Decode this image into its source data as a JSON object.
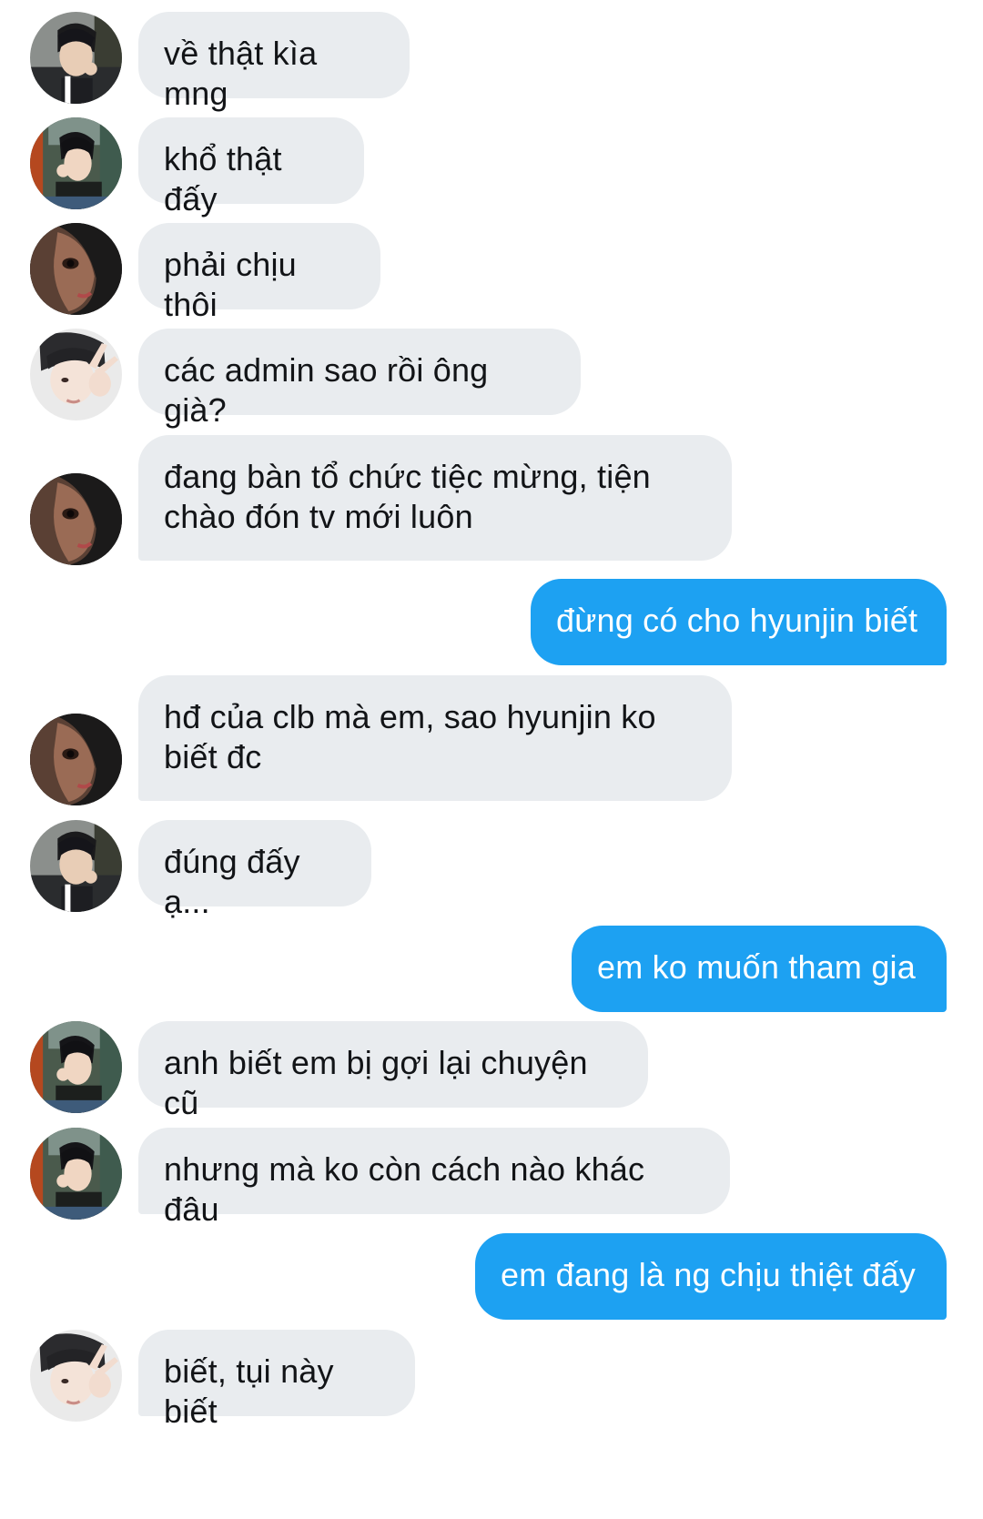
{
  "conversation": {
    "messages": [
      {
        "side": "in",
        "avatar": "avatar-a",
        "text": "về thật kìa mng"
      },
      {
        "side": "in",
        "avatar": "avatar-b",
        "text": "khổ thật đấy"
      },
      {
        "side": "in",
        "avatar": "avatar-c",
        "text": "phải chịu thôi"
      },
      {
        "side": "in",
        "avatar": "avatar-d",
        "text": "các admin sao rồi ông già?"
      },
      {
        "side": "in",
        "avatar": "avatar-c",
        "text": "đang bàn tổ chức tiệc mừng, tiện\nchào đón tv mới luôn"
      },
      {
        "side": "out",
        "avatar": "",
        "text": "đừng có cho hyunjin biết"
      },
      {
        "side": "in",
        "avatar": "avatar-c",
        "text": "hđ của clb mà em, sao hyunjin ko\nbiết đc"
      },
      {
        "side": "in",
        "avatar": "avatar-a",
        "text": "đúng đấy ạ..."
      },
      {
        "side": "out",
        "avatar": "",
        "text": "em ko muốn tham gia"
      },
      {
        "side": "in",
        "avatar": "avatar-b",
        "text": "anh biết em bị gợi lại chuyện cũ"
      },
      {
        "side": "in",
        "avatar": "avatar-b",
        "text": "nhưng mà ko còn cách nào khác đâu"
      },
      {
        "side": "out",
        "avatar": "",
        "text": "em đang là ng chịu thiệt đấy"
      },
      {
        "side": "in",
        "avatar": "avatar-d",
        "text": "biết, tụi này biết"
      }
    ]
  },
  "colors": {
    "incoming_bubble": "#e9ecef",
    "outgoing_bubble": "#1da1f2",
    "incoming_text": "#121417",
    "outgoing_text": "#ffffff"
  }
}
